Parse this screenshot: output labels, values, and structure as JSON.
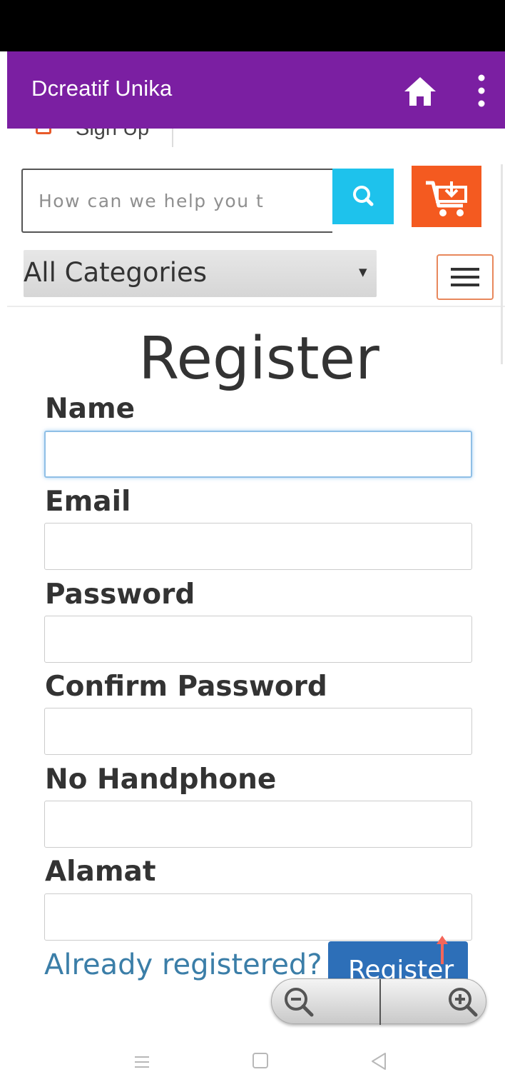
{
  "app_bar": {
    "title": "Dcreatif Unika",
    "home_icon": "home-icon",
    "menu_icon": "more-vert-icon",
    "color": "#7b1fa2"
  },
  "header": {
    "signup_label": "Sign Up",
    "search": {
      "placeholder": "How can we help you t",
      "button_icon": "search-icon",
      "button_color": "#1ec2ec"
    },
    "cart": {
      "icon": "cart-icon",
      "color": "#f45a20"
    },
    "category": {
      "selected": "All Categories"
    },
    "menu_toggle_icon": "hamburger-icon"
  },
  "form": {
    "title": "Register",
    "fields": [
      {
        "label": "Name",
        "value": ""
      },
      {
        "label": "Email",
        "value": ""
      },
      {
        "label": "Password",
        "value": ""
      },
      {
        "label": "Confirm Password",
        "value": ""
      },
      {
        "label": "No Handphone",
        "value": ""
      },
      {
        "label": "Alamat",
        "value": ""
      }
    ],
    "already_registered": "Already registered?",
    "submit_label": "Register",
    "submit_color": "#2d6fb8"
  },
  "zoom": {
    "out_icon": "zoom-out-icon",
    "in_icon": "zoom-in-icon"
  },
  "nav_bar": {
    "recents_icon": "recents-icon",
    "home_icon": "home-square-icon",
    "back_icon": "back-triangle-icon"
  }
}
